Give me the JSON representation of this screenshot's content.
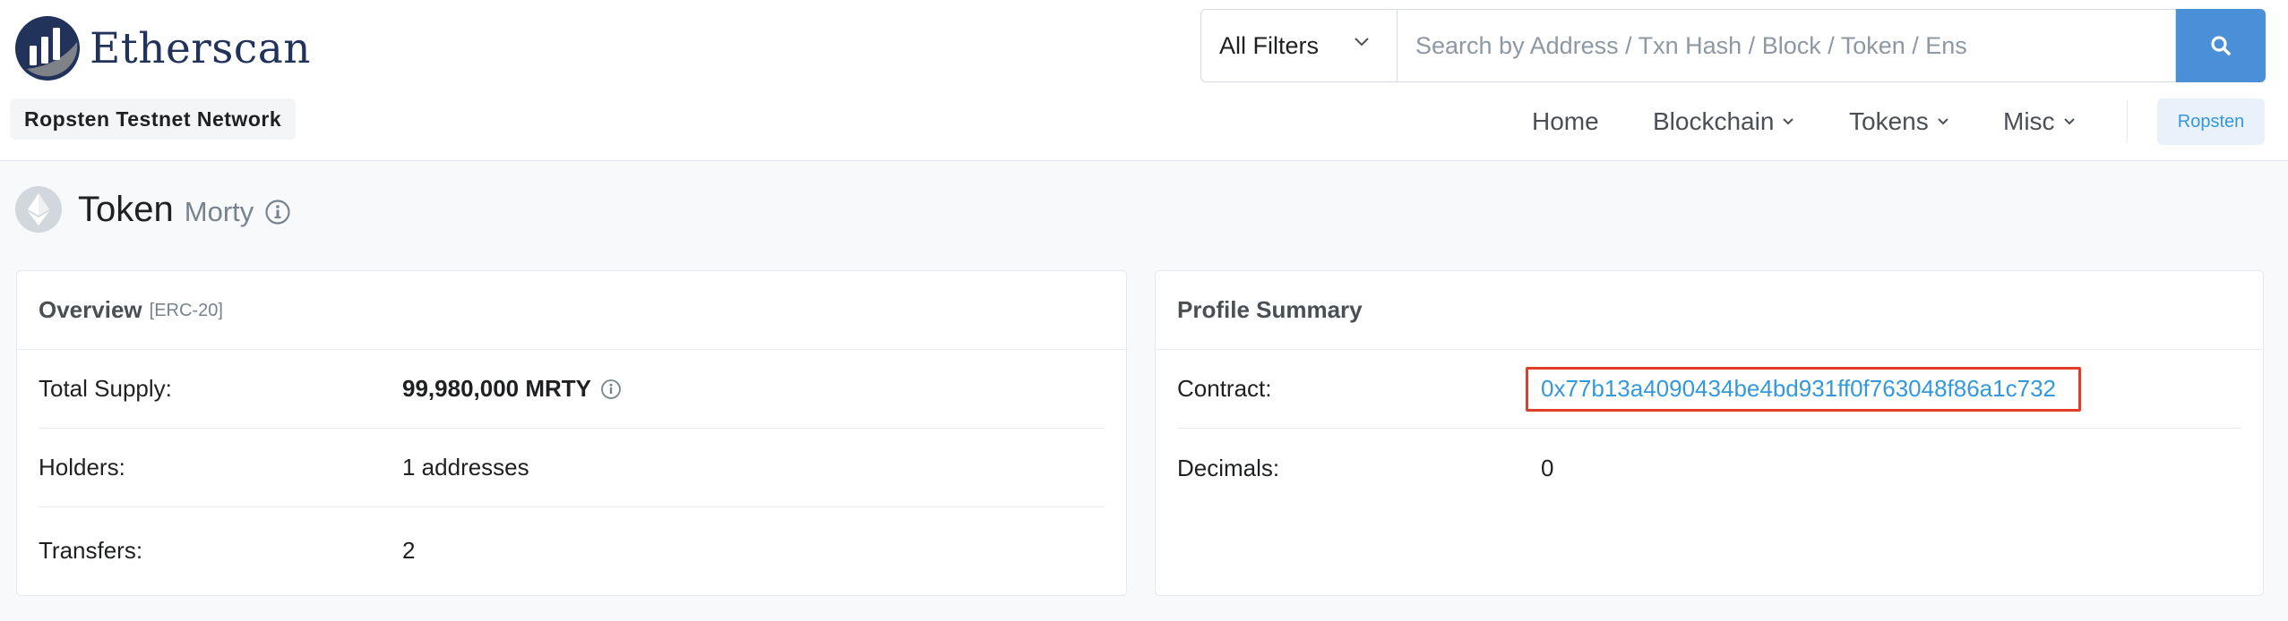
{
  "app": {
    "logo_text": "Etherscan",
    "network_badge": "Ropsten Testnet Network"
  },
  "search": {
    "filter_label": "All Filters",
    "placeholder": "Search by Address / Txn Hash / Block / Token / Ens"
  },
  "nav": {
    "home": "Home",
    "blockchain": "Blockchain",
    "tokens": "Tokens",
    "misc": "Misc",
    "network_button": "Ropsten"
  },
  "page": {
    "title": "Token",
    "subtitle": "Morty"
  },
  "overview": {
    "title": "Overview",
    "tag": "[ERC-20]",
    "rows": [
      {
        "label": "Total Supply:",
        "value": "99,980,000 MRTY"
      },
      {
        "label": "Holders:",
        "value": "1 addresses"
      },
      {
        "label": "Transfers:",
        "value": "2"
      }
    ]
  },
  "profile": {
    "title": "Profile Summary",
    "rows": [
      {
        "label": "Contract:",
        "value": "0x77b13a4090434be4bd931ff0f763048f86a1c732"
      },
      {
        "label": "Decimals:",
        "value": "0"
      }
    ]
  },
  "colors": {
    "accent": "#3498db",
    "search_button": "#4a90d9",
    "highlight": "#e23d28",
    "brand_navy": "#21325b"
  },
  "icons": {
    "logo": "etherscan-logo-icon",
    "search": "search-icon",
    "filter_caret": "chevron-down-icon",
    "token": "ethereum-icon",
    "info": "info-icon"
  }
}
